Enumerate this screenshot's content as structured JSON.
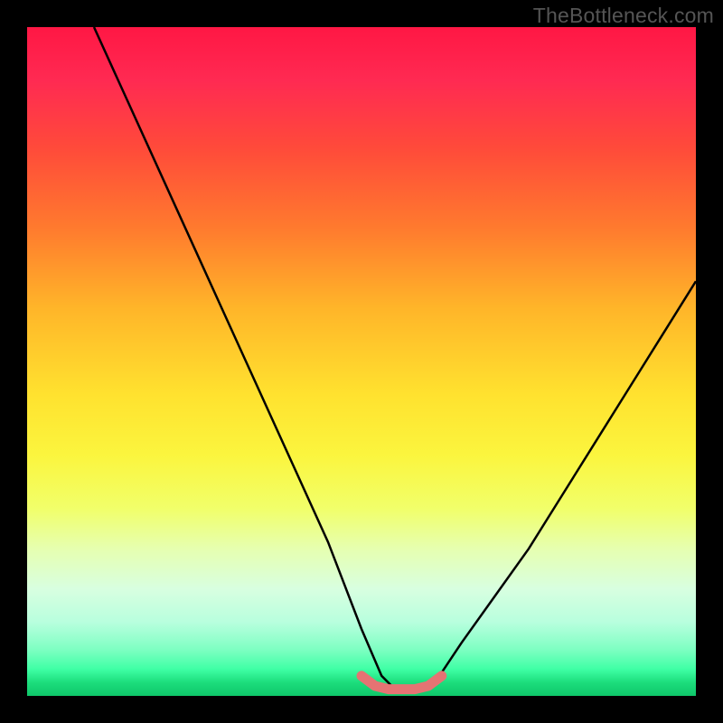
{
  "watermark": "TheBottleneck.com",
  "chart_data": {
    "type": "line",
    "title": "",
    "xlabel": "",
    "ylabel": "",
    "xlim": [
      0,
      100
    ],
    "ylim": [
      0,
      100
    ],
    "grid": false,
    "series": [
      {
        "name": "curve",
        "color": "#000000",
        "x": [
          10,
          15,
          20,
          25,
          30,
          35,
          40,
          45,
          50,
          53,
          55,
          57,
          59,
          61,
          65,
          70,
          75,
          80,
          85,
          90,
          95,
          100
        ],
        "values": [
          100,
          89,
          78,
          67,
          56,
          45,
          34,
          23,
          10,
          3,
          1,
          1,
          1,
          2,
          8,
          15,
          22,
          30,
          38,
          46,
          54,
          62
        ]
      }
    ],
    "annotations": [
      {
        "name": "valley-highlight",
        "type": "path",
        "color": "#e57373",
        "x": [
          50,
          52,
          54,
          56,
          58,
          60,
          62
        ],
        "values": [
          3.0,
          1.5,
          1.0,
          1.0,
          1.0,
          1.5,
          3.0
        ]
      }
    ]
  }
}
